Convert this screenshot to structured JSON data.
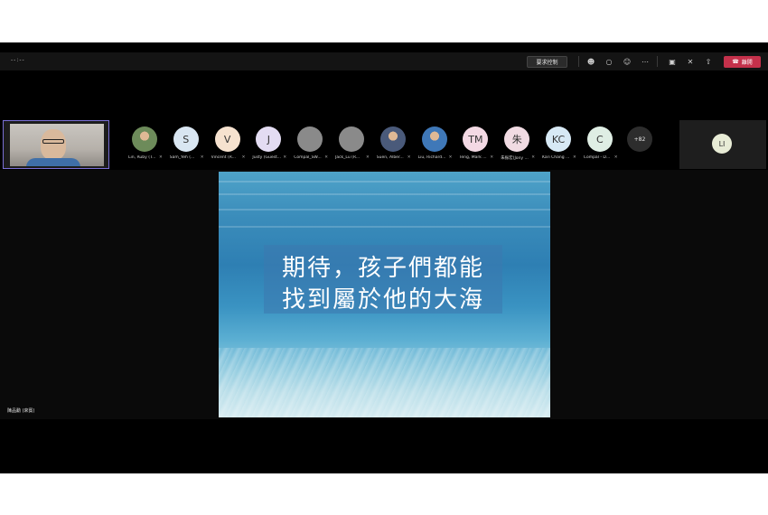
{
  "toolbar": {
    "timer": "--:--",
    "request_control_label": "要求控制",
    "leave_label": "離開",
    "leave_color": "#c4314b",
    "icons": [
      "people-icon",
      "chat-icon",
      "reactions-icon",
      "more-icon",
      "camera-icon",
      "mic-off-icon",
      "share-icon",
      "phone-icon"
    ]
  },
  "self_view": {
    "name": "陳品勳 (來賓)"
  },
  "participants": [
    {
      "name": "Lin, Ruby (T...",
      "initials": "",
      "photo": true,
      "color": "#6d8b5a"
    },
    {
      "name": "Sam_Yeh (...",
      "initials": "S",
      "photo": false,
      "color": "#d9e6f2"
    },
    {
      "name": "Vincent (R...",
      "initials": "V",
      "photo": false,
      "color": "#f6e2cf"
    },
    {
      "name": "Justy (Guest...",
      "initials": "J",
      "photo": false,
      "color": "#e3dcf2"
    },
    {
      "name": "Compal_SW...",
      "initials": "",
      "photo": false,
      "color": "#8a8a8a"
    },
    {
      "name": "Jack_Lu (R...",
      "initials": "",
      "photo": false,
      "color": "#8a8a8a"
    },
    {
      "name": "Suen, Alber...",
      "initials": "",
      "photo": true,
      "color": "#4a5a7a"
    },
    {
      "name": "Liu, Richard...",
      "initials": "",
      "photo": true,
      "color": "#3f78b8"
    },
    {
      "name": "Teng, Mark ...",
      "initials": "TM",
      "photo": false,
      "color": "#f3d9e4"
    },
    {
      "name": "朱振宏(Jony ...",
      "initials": "朱",
      "photo": false,
      "color": "#f1dbe3"
    },
    {
      "name": "Kari Chang ...",
      "initials": "KC",
      "photo": false,
      "color": "#d7e9f5"
    },
    {
      "name": "Compal - D...",
      "initials": "C",
      "photo": false,
      "color": "#dfeee4"
    }
  ],
  "more_participants": "+82",
  "side_panel": {
    "initials": "LI"
  },
  "slide": {
    "line1": "期待，孩子們都能",
    "line2": "找到屬於他的大海"
  }
}
